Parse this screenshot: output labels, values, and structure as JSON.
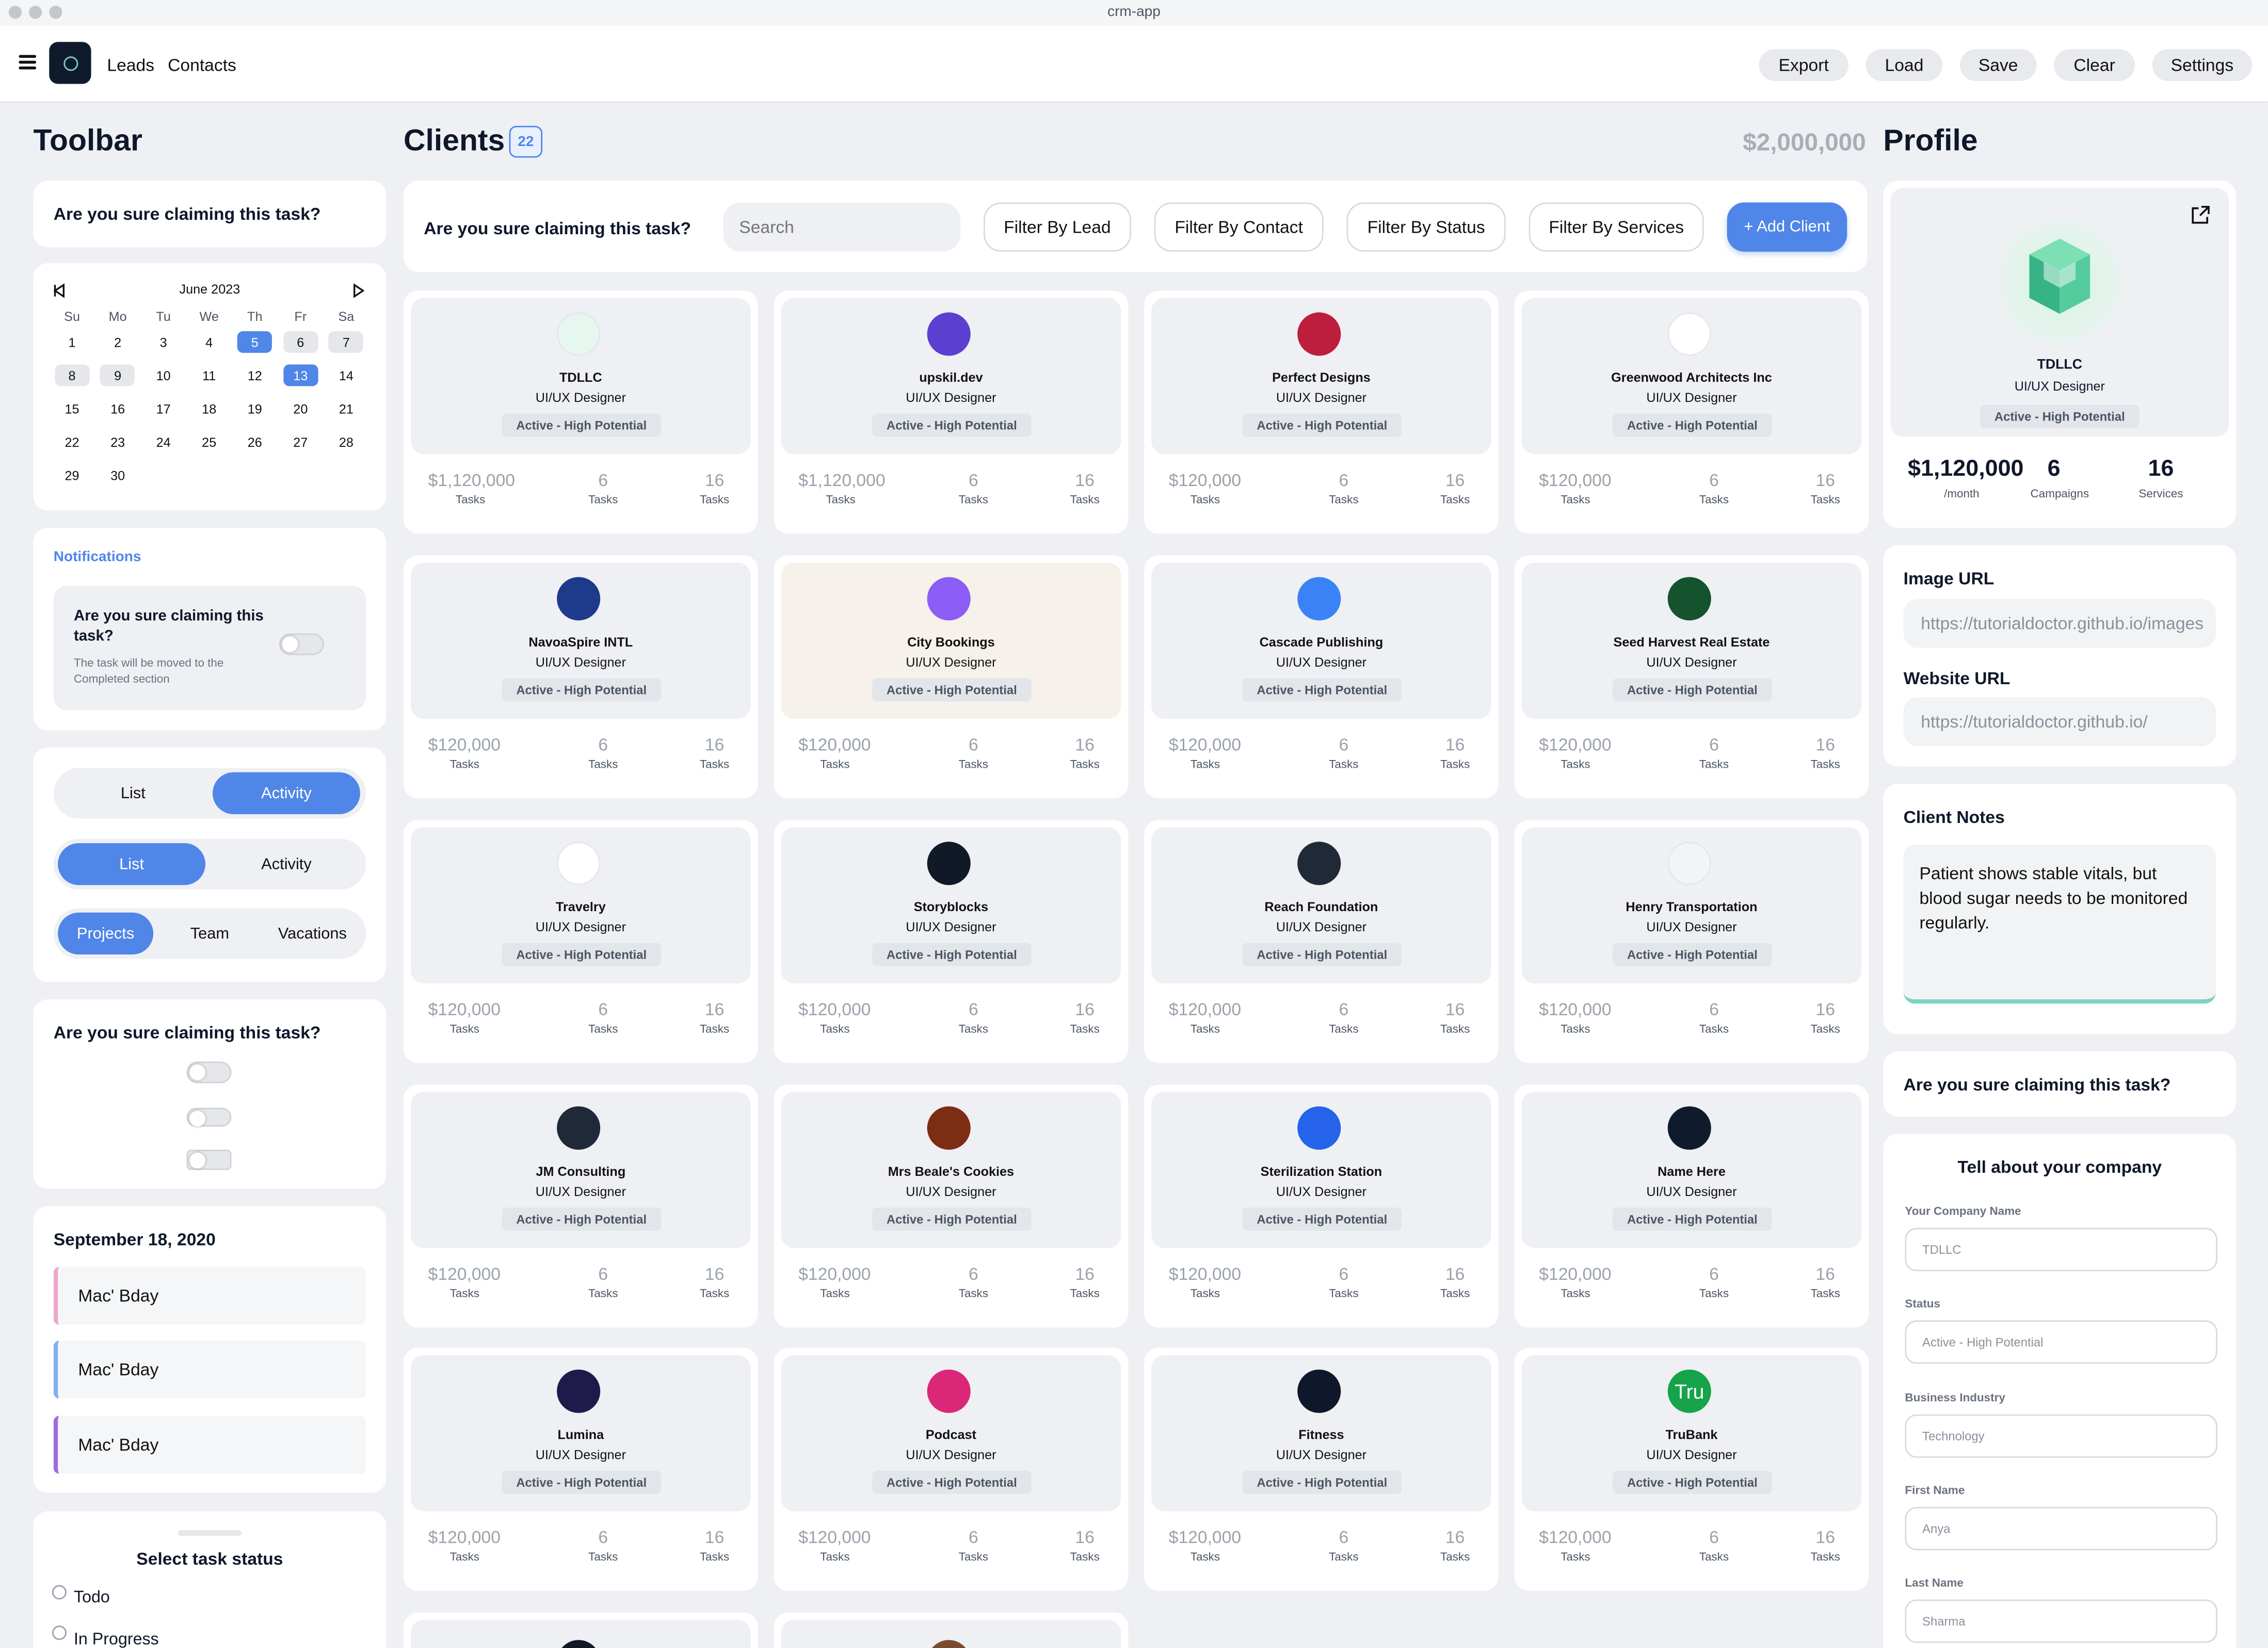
{
  "window": {
    "title": "crm-app"
  },
  "nav": {
    "links": [
      "Leads",
      "Contacts"
    ]
  },
  "header_buttons": {
    "export": "Export",
    "load": "Load",
    "save": "Save",
    "clear": "Clear",
    "settings": "Settings"
  },
  "toolbar": {
    "title": "Toolbar",
    "confirm_question": "Are you sure claiming this task?",
    "calendar": {
      "month": "June 2023",
      "weekdays": [
        "Su",
        "Mo",
        "Tu",
        "We",
        "Th",
        "Fr",
        "Sa"
      ],
      "days": [
        "1",
        "2",
        "3",
        "4",
        "5",
        "6",
        "7",
        "8",
        "9",
        "10",
        "11",
        "12",
        "13",
        "14",
        "15",
        "16",
        "17",
        "18",
        "19",
        "20",
        "21",
        "22",
        "23",
        "24",
        "25",
        "26",
        "27",
        "28",
        "29",
        "30"
      ],
      "selected_days": [
        "5",
        "13"
      ],
      "highlighted_days": [
        "5",
        "6",
        "7",
        "8",
        "9",
        "13"
      ]
    },
    "notifications": {
      "title": "Notifications",
      "question": "Are you sure claiming this task?",
      "description": "The task will be moved to the Completed section"
    },
    "segments": {
      "first": {
        "left": "List",
        "right": "Activity",
        "selected": "Activity"
      },
      "second": {
        "left": "List",
        "right": "Activity",
        "selected": "List"
      },
      "third": {
        "a": "Projects",
        "b": "Team",
        "c": "Vacations",
        "selected": "Projects"
      }
    },
    "switches_question": "Are you sure claiming this task?",
    "events": {
      "date": "September 18, 2020",
      "items": [
        "Mac' Bday",
        "Mac' Bday",
        "Mac' Bday"
      ],
      "colors": [
        "#f0a6c8",
        "#7fb0ef",
        "#a06ae0"
      ]
    },
    "task_status": {
      "title": "Select task status",
      "options": [
        "Todo",
        "In Progress"
      ]
    }
  },
  "clients": {
    "title": "Clients",
    "count": "22",
    "total": "$2,000,000",
    "question": "Are you sure claiming this task?",
    "search_placeholder": "Search",
    "filters": [
      "Filter By Lead",
      "Filter By Contact",
      "Filter By Status",
      "Filter By Services"
    ],
    "add_label": "+ Add Client",
    "role": "UI/UX Designer",
    "status": "Active - High Potential",
    "stat_label": "Tasks",
    "tasks": "6",
    "services": "16",
    "cards": [
      {
        "name": "TDLLC",
        "value": "$1,120,000",
        "avatar": "cube-logo-icon",
        "color": "#e6f7ef"
      },
      {
        "name": "upskil.dev",
        "value": "$1,120,000",
        "avatar": "layers-logo-icon",
        "color": "#5b3fd1"
      },
      {
        "name": "Perfect Designs",
        "value": "$120,000",
        "avatar": "pinterest-logo-icon",
        "color": "#bd1e3b"
      },
      {
        "name": "Greenwood Architects Inc",
        "value": "$120,000",
        "avatar": "triangle-logo-icon",
        "color": "#ffffff"
      },
      {
        "name": "NavoaSpire INTL",
        "value": "$120,000",
        "avatar": "sun-cloud-logo-icon",
        "color": "#1e3a8a"
      },
      {
        "name": "City Bookings",
        "value": "$120,000",
        "avatar": "calendar-logo-icon",
        "color": "#8b5cf6"
      },
      {
        "name": "Cascade Publishing",
        "value": "$120,000",
        "avatar": "paper-plane-logo-icon",
        "color": "#3b82f6"
      },
      {
        "name": "Seed Harvest Real Estate",
        "value": "$120,000",
        "avatar": "sprout-logo-icon",
        "color": "#14532d"
      },
      {
        "name": "Travelry",
        "value": "$120,000",
        "avatar": "map-pins-logo-icon",
        "color": "#ffffff"
      },
      {
        "name": "Storyblocks",
        "value": "$120,000",
        "avatar": "blocks-logo-icon",
        "color": "#111827"
      },
      {
        "name": "Reach Foundation",
        "value": "$120,000",
        "avatar": "reach-logo-icon",
        "color": "#1f2937"
      },
      {
        "name": "Henry Transportation",
        "value": "$120,000",
        "avatar": "truck-logo-icon",
        "color": "#f3f4f6"
      },
      {
        "name": "JM Consulting",
        "value": "$120,000",
        "avatar": "jm-logo-icon",
        "color": "#1f2937"
      },
      {
        "name": "Mrs Beale's Cookies",
        "value": "$120,000",
        "avatar": "cookie-logo-icon",
        "color": "#7c2d12"
      },
      {
        "name": "Sterilization Station",
        "value": "$120,000",
        "avatar": "station-logo-icon",
        "color": "#2563eb"
      },
      {
        "name": "Name Here",
        "value": "$120,000",
        "avatar": "name-here-logo-icon",
        "color": "#0f1b2d"
      },
      {
        "name": "Lumina",
        "value": "$120,000",
        "avatar": "lumina-logo-icon",
        "color": "#1e1b4b"
      },
      {
        "name": "Podcast",
        "value": "$120,000",
        "avatar": "microphone-logo-icon",
        "color": "#db2777"
      },
      {
        "name": "Fitness",
        "value": "$120,000",
        "avatar": "fitness-logo-icon",
        "color": "#0f172a"
      },
      {
        "name": "TruBank",
        "value": "$120,000",
        "avatar": "trubank-logo-icon",
        "color": "#16a34a",
        "text": "Tru"
      }
    ]
  },
  "profile": {
    "title": "Profile",
    "name": "TDLLC",
    "role": "UI/UX Designer",
    "status": "Active - High Potential",
    "stats": [
      {
        "value": "$1,120,000",
        "label": "/month"
      },
      {
        "value": "6",
        "label": "Campaigns"
      },
      {
        "value": "16",
        "label": "Services"
      }
    ],
    "image_url_label": "Image URL",
    "image_url": "https://tutorialdoctor.github.io/images",
    "website_url_label": "Website URL",
    "website_url": "https://tutorialdoctor.github.io/",
    "notes_label": "Client Notes",
    "notes": "Patient shows stable vitals, but blood sugar needs to be monitored regularly.",
    "question": "Are you sure claiming this task?",
    "company_form": {
      "title": "Tell about your company",
      "fields": [
        {
          "label": "Your Company Name",
          "value": "TDLLC"
        },
        {
          "label": "Status",
          "value": "Active - High Potential"
        },
        {
          "label": "Business Industry",
          "value": "Technology"
        },
        {
          "label": "First Name",
          "value": "Anya"
        },
        {
          "label": "Last Name",
          "value": "Sharma"
        }
      ]
    }
  },
  "colors": {
    "accent": "#4f86e8",
    "teal": "#7dd3c0",
    "background": "#eef0f3"
  }
}
